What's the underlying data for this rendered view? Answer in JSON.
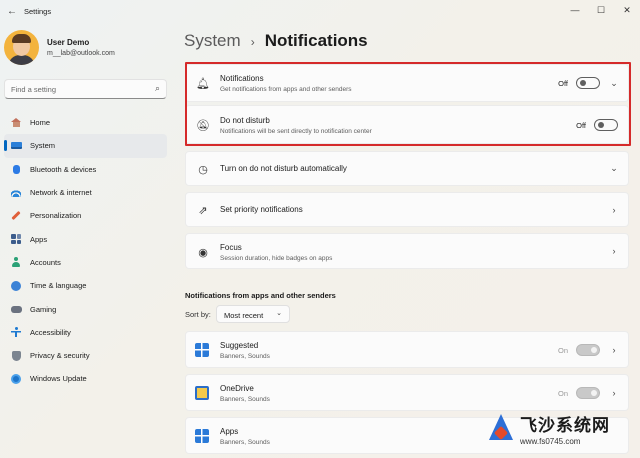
{
  "window": {
    "title": "Settings",
    "back_icon": "arrow-left-icon",
    "controls": [
      "minimize-icon",
      "maximize-icon",
      "close-icon"
    ]
  },
  "profile": {
    "name": "User Demo",
    "email": "m__lab@outlook.com"
  },
  "search": {
    "placeholder": "Find a setting"
  },
  "sidebar": {
    "items": [
      {
        "label": "Home",
        "icon": "home-icon",
        "active": false
      },
      {
        "label": "System",
        "icon": "system-icon",
        "active": true
      },
      {
        "label": "Bluetooth & devices",
        "icon": "bluetooth-icon",
        "active": false
      },
      {
        "label": "Network & internet",
        "icon": "network-icon",
        "active": false
      },
      {
        "label": "Personalization",
        "icon": "brush-icon",
        "active": false
      },
      {
        "label": "Apps",
        "icon": "apps-icon",
        "active": false
      },
      {
        "label": "Accounts",
        "icon": "accounts-icon",
        "active": false
      },
      {
        "label": "Time & language",
        "icon": "time-language-icon",
        "active": false
      },
      {
        "label": "Gaming",
        "icon": "gaming-icon",
        "active": false
      },
      {
        "label": "Accessibility",
        "icon": "accessibility-icon",
        "active": false
      },
      {
        "label": "Privacy & security",
        "icon": "shield-icon",
        "active": false
      },
      {
        "label": "Windows Update",
        "icon": "update-icon",
        "active": false
      }
    ]
  },
  "breadcrumb": {
    "parent": "System",
    "separator": "›",
    "current": "Notifications"
  },
  "settings": {
    "notifications": {
      "title": "Notifications",
      "subtitle": "Get notifications from apps and other senders",
      "state": "Off",
      "icon": "bell-icon"
    },
    "dnd": {
      "title": "Do not disturb",
      "subtitle": "Notifications will be sent directly to notification center",
      "state": "Off",
      "icon": "bell-snooze-icon"
    },
    "dnd_auto": {
      "title": "Turn on do not disturb automatically",
      "icon": "clock-icon"
    },
    "priority": {
      "title": "Set priority notifications",
      "icon": "priority-icon"
    },
    "focus": {
      "title": "Focus",
      "subtitle": "Session duration, hide badges on apps",
      "icon": "focus-icon"
    }
  },
  "senders": {
    "section_title": "Notifications from apps and other senders",
    "sort_label": "Sort by:",
    "sort_value": "Most recent",
    "apps": [
      {
        "name": "Suggested",
        "sub": "Banners, Sounds",
        "state": "On"
      },
      {
        "name": "OneDrive",
        "sub": "Banners, Sounds",
        "state": "On"
      },
      {
        "name": "Apps",
        "sub": "Banners, Sounds",
        "state": ""
      }
    ]
  },
  "watermark": {
    "text": "飞沙系统网",
    "url": "www.fs0745.com"
  },
  "colors": {
    "accent": "#0067c0",
    "highlight_border": "#d52a2a"
  }
}
